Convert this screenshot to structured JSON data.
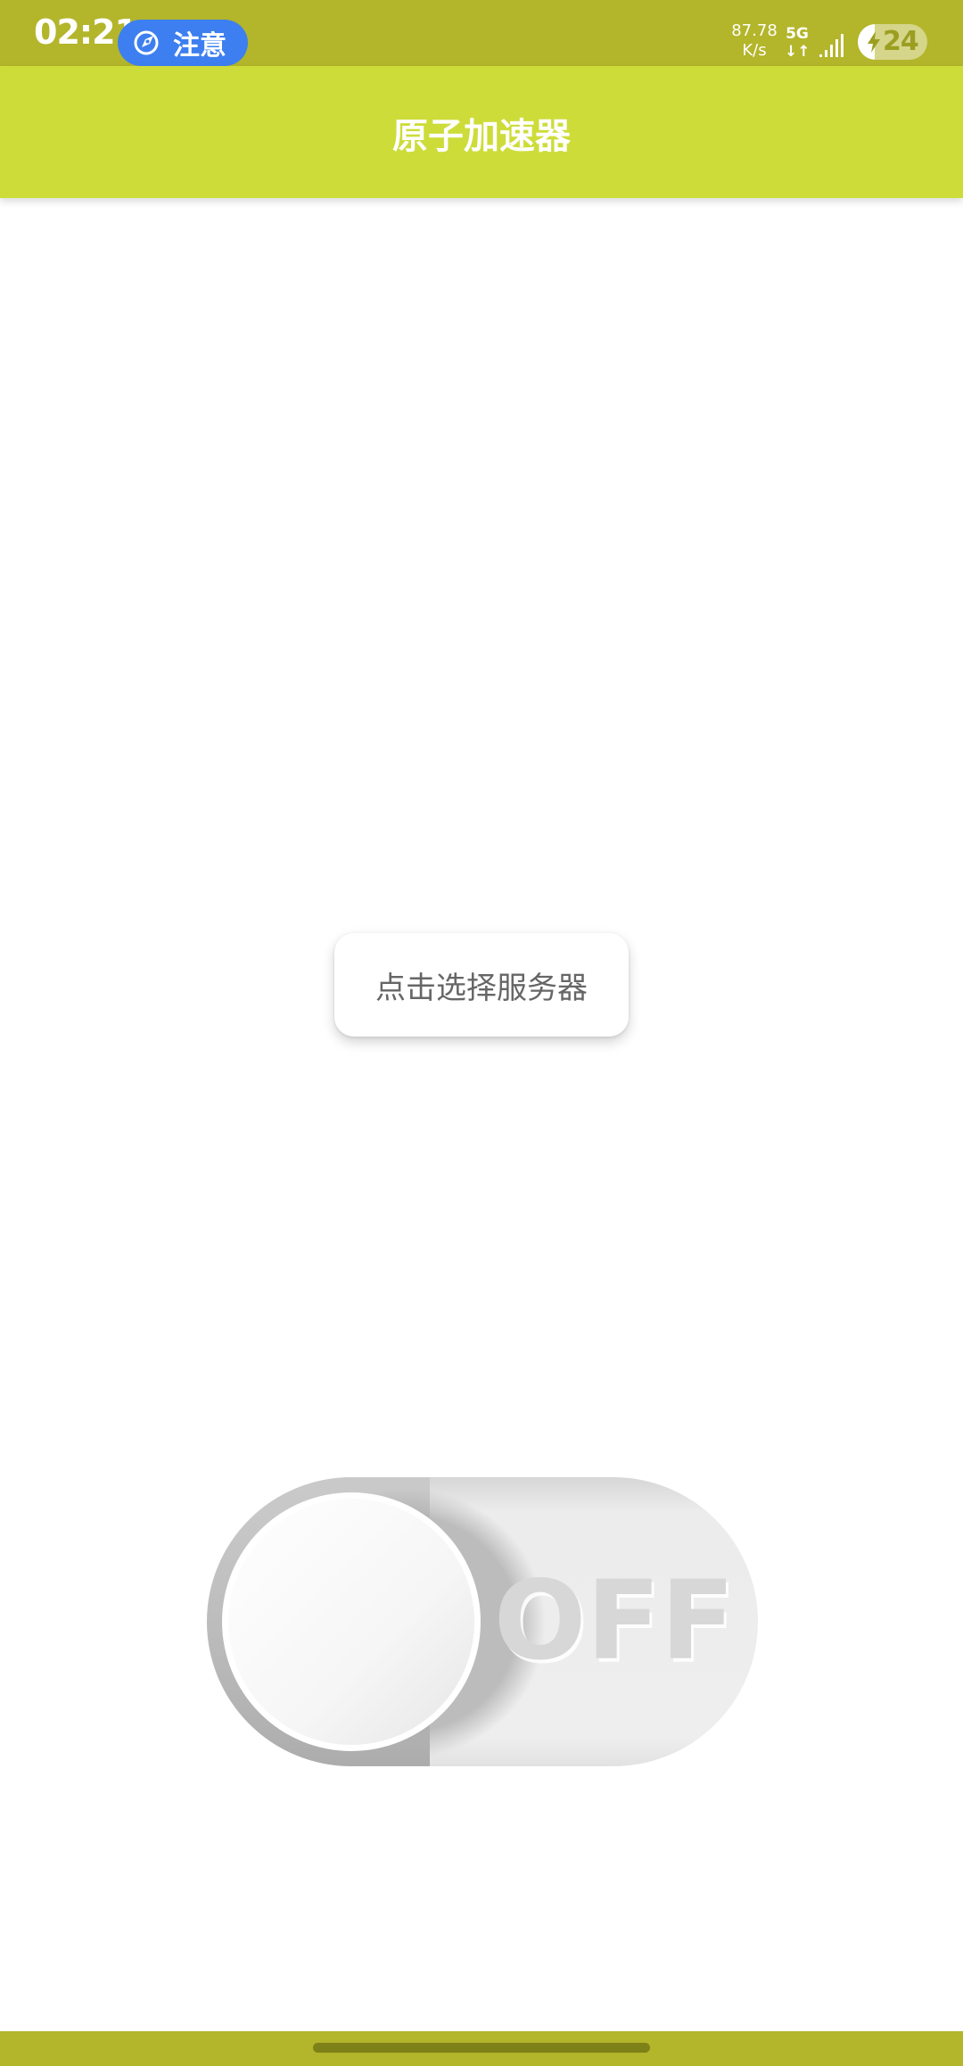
{
  "status_bar": {
    "time": "02:21",
    "notice_label": "注意",
    "net_speed_value": "87.78",
    "net_speed_unit": "K/s",
    "network_type": "5G",
    "network_arrows": "↓↑",
    "battery_level": "24",
    "battery_percent": 24,
    "colors": {
      "background": "#b3b52b",
      "notice_pill": "#3d7ff0"
    }
  },
  "app_bar": {
    "title": "原子加速器",
    "color": "#cddc39"
  },
  "main": {
    "server_button_label": "点击选择服务器",
    "toggle": {
      "state": "OFF",
      "label": "OFF"
    }
  },
  "icons": {
    "notice": "compass-rocket-icon",
    "signal": "cell-signal-icon",
    "battery": "battery-charging-icon"
  }
}
